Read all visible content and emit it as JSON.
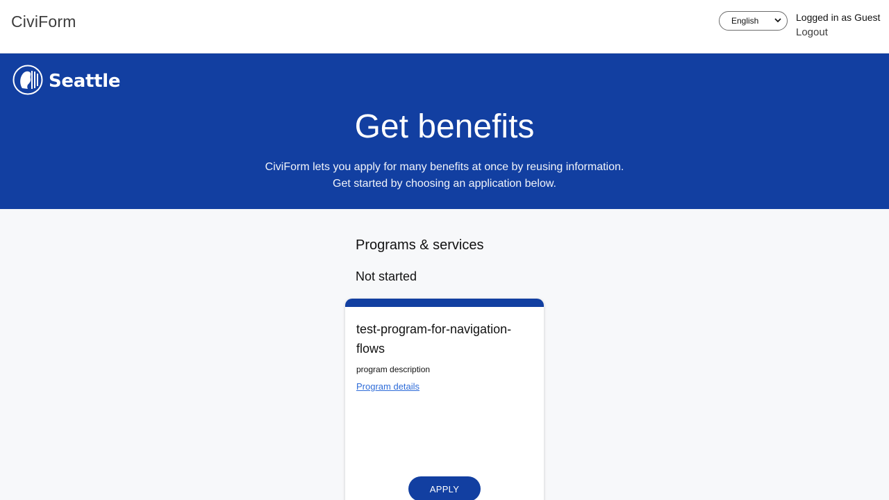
{
  "header": {
    "brand": "CiviForm",
    "language": {
      "selected": "English"
    },
    "logged_in_text": "Logged in as Guest",
    "logout_label": "Logout"
  },
  "hero": {
    "logo_text": "Seattle",
    "title": "Get benefits",
    "line1": "CiviForm lets you apply for many benefits at once by reusing information.",
    "line2": "Get started by choosing an application below."
  },
  "main": {
    "section_title": "Programs & services",
    "status_heading": "Not started",
    "programs": [
      {
        "title": "test-program-for-navigation-flows",
        "description": "program description",
        "details_label": "Program details",
        "apply_label": "APPLY"
      }
    ]
  },
  "colors": {
    "brand_blue": "#123fa1",
    "link_blue": "#2d6bd8",
    "page_bg": "#f7f8fa"
  },
  "icons": {
    "logo": "seattle-seal-icon",
    "dropdown": "chevron-down-icon"
  }
}
